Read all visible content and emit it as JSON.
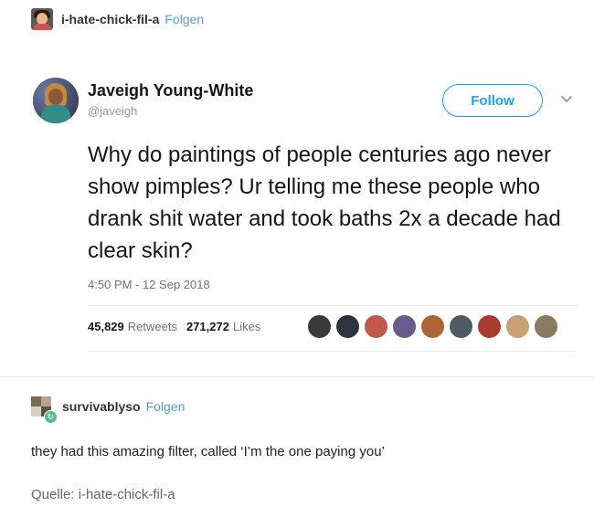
{
  "post": {
    "blog_name": "i-hate-chick-fil-a",
    "follow_label": "Folgen"
  },
  "tweet": {
    "name": "Javeigh Young-White",
    "handle": "@javeigh",
    "follow_label": "Follow",
    "text": "Why do paintings of people centuries ago never show pimples? Ur telling me these people who drank shit water and took baths 2x a decade had clear skin?",
    "timestamp": "4:50 PM - 12 Sep 2018",
    "retweets_count": "45,829",
    "retweets_label": "Retweets",
    "likes_count": "271,272",
    "likes_label": "Likes",
    "liker_colors": [
      "#3a3a3a",
      "#2f3340",
      "#c0594a",
      "#6b5b8a",
      "#b0643a",
      "#4f5a66",
      "#a83b30",
      "#c9a074",
      "#8a7a60"
    ]
  },
  "reblog": {
    "blog_name": "survivablyso",
    "follow_label": "Folgen",
    "comment": "they had this amazing filter, called ‘I’m the one paying you’",
    "source": "Quelle: i-hate-chick-fil-a"
  },
  "colors": {
    "twitter_blue": "#1da1f2",
    "tumblr_blue": "#529ecc",
    "reblog_green": "#56bc8a"
  }
}
